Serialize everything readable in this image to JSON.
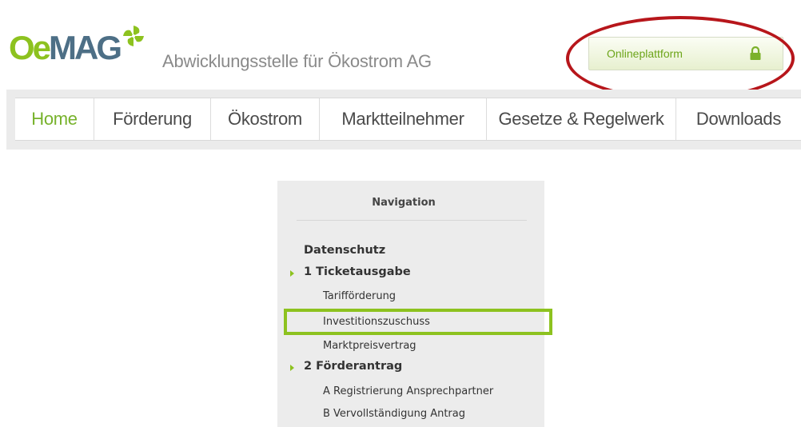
{
  "header": {
    "logo_primary": "Oe",
    "logo_secondary": "MAG",
    "tagline": "Abwicklungsstelle für Ökostrom AG",
    "platform_button": "Onlineplattform",
    "icons": {
      "logo_mark": "pinwheel-icon",
      "platform": "lock-icon"
    },
    "colors": {
      "brand_green": "#8dc21f",
      "brand_blue": "#4d6f86",
      "annotation_red": "#b7161b"
    }
  },
  "nav": {
    "items": [
      {
        "label": "Home",
        "active": true
      },
      {
        "label": "Förderung"
      },
      {
        "label": "Ökostrom"
      },
      {
        "label": "Marktteilnehmer"
      },
      {
        "label": "Gesetze & Regelwerk"
      },
      {
        "label": "Downloads"
      }
    ]
  },
  "panel": {
    "title": "Navigation",
    "items": [
      {
        "label": "Datenschutz",
        "type": "section"
      },
      {
        "label": "1 Ticketausgabe",
        "type": "group"
      },
      {
        "label": "Tarifförderung",
        "type": "sub"
      },
      {
        "label": "Investitionszuschuss",
        "type": "sub",
        "highlighted": true
      },
      {
        "label": "Marktpreisvertrag",
        "type": "sub"
      },
      {
        "label": "2 Förderantrag",
        "type": "group"
      },
      {
        "label": "A Registrierung Ansprechpartner",
        "type": "sub"
      },
      {
        "label": "B Vervollständigung Antrag",
        "type": "sub"
      }
    ]
  }
}
